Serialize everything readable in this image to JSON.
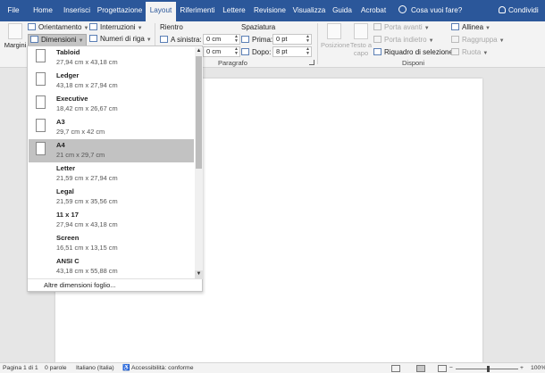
{
  "tabs": [
    "File",
    "Home",
    "Inserisci",
    "Progettazione",
    "Layout",
    "Riferimenti",
    "Lettere",
    "Revisione",
    "Visualizza",
    "Guida",
    "Acrobat"
  ],
  "active_tab": "Layout",
  "tell_me": "Cosa vuoi fare?",
  "share": "Condividi",
  "ribbon": {
    "margini": "Margini",
    "orientamento": "Orientamento",
    "dimensioni": "Dimensioni",
    "interruzioni": "Interruzioni",
    "numeri_riga": "Numeri di riga",
    "rientro": "Rientro",
    "a_sinistra_label": "A sinistra:",
    "a_sinistra_value": "0 cm",
    "a_destra_value": "0 cm",
    "spaziatura": "Spaziatura",
    "prima_label": "Prima:",
    "prima_value": "0 pt",
    "dopo_label": "Dopo:",
    "dopo_value": "8 pt",
    "paragrafo_group": "Paragrafo",
    "posizione": "Posizione",
    "testo_a_capo": "Testo a capo",
    "porta_avanti": "Porta avanti",
    "porta_indietro": "Porta indietro",
    "riquadro_selezione": "Riquadro di selezione",
    "allinea": "Allinea",
    "raggruppa": "Raggruppa",
    "ruota": "Ruota",
    "disponi_group": "Disponi"
  },
  "dropdown": {
    "items": [
      {
        "name": "Tabloid",
        "size": "27,94 cm x 43,18 cm"
      },
      {
        "name": "Ledger",
        "size": "43,18 cm x 27,94 cm"
      },
      {
        "name": "Executive",
        "size": "18,42 cm x 26,67 cm"
      },
      {
        "name": "A3",
        "size": "29,7 cm x 42 cm"
      },
      {
        "name": "A4",
        "size": "21 cm x 29,7 cm"
      },
      {
        "name": "Letter",
        "size": "21,59 cm x 27,94 cm"
      },
      {
        "name": "Legal",
        "size": "21,59 cm x 35,56 cm"
      },
      {
        "name": "11 x 17",
        "size": "27,94 cm x 43,18 cm"
      },
      {
        "name": "Screen",
        "size": "16,51 cm x 13,15 cm"
      },
      {
        "name": "ANSI C",
        "size": "43,18 cm x 55,88 cm"
      }
    ],
    "selected": "A4",
    "more": "Altre dimensioni foglio..."
  },
  "status": {
    "page": "Pagina 1 di 1",
    "words": "0 parole",
    "language": "Italiano (Italia)",
    "accessibility": "Accessibilità: conforme",
    "zoom": "100%"
  }
}
